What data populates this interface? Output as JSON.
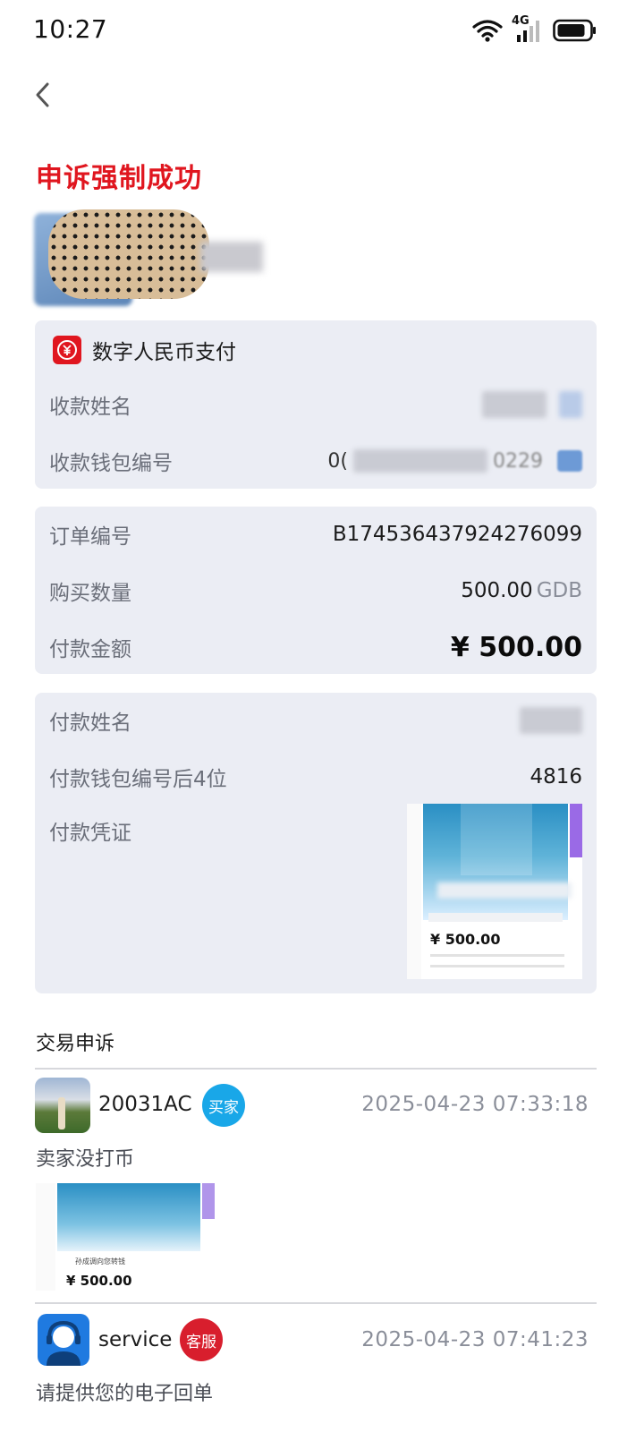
{
  "status_bar": {
    "time": "10:27",
    "network": "4G"
  },
  "header": {
    "title": "申诉强制成功"
  },
  "payment_method": {
    "title": "数字人民币支付",
    "icon": "digital-rmb-icon",
    "payee_name_label": "收款姓名",
    "wallet_id_label": "收款钱包编号",
    "wallet_id_partial_start": "0(",
    "wallet_id_partial_end": "0229"
  },
  "order": {
    "order_no_label": "订单编号",
    "order_no": "B174536437924276099",
    "quantity_label": "购买数量",
    "quantity": "500.00",
    "quantity_unit": "GDB",
    "amount_label": "付款金额",
    "amount": "¥ 500.00"
  },
  "payer": {
    "name_label": "付款姓名",
    "wallet_last4_label": "付款钱包编号后4位",
    "wallet_last4": "4816",
    "voucher_label": "付款凭证",
    "voucher_amount": "¥ 500.00"
  },
  "appeal": {
    "section_title": "交易申诉",
    "messages": [
      {
        "user": "20031AC",
        "badge": "买家",
        "time": "2025-04-23 07:33:18",
        "text": "卖家没打币",
        "attachment_amount": "¥ 500.00",
        "attachment_caption": "孙成调向您转钱"
      },
      {
        "user": "service",
        "badge": "客服",
        "time": "2025-04-23 07:41:23",
        "text": "请提供您的电子回单"
      }
    ]
  },
  "colors": {
    "title_red": "#e0161f",
    "card_bg": "#ebedf4",
    "buyer_badge": "#19a7e8",
    "service_badge": "#d81e2d",
    "service_avatar": "#1f7ae0"
  }
}
